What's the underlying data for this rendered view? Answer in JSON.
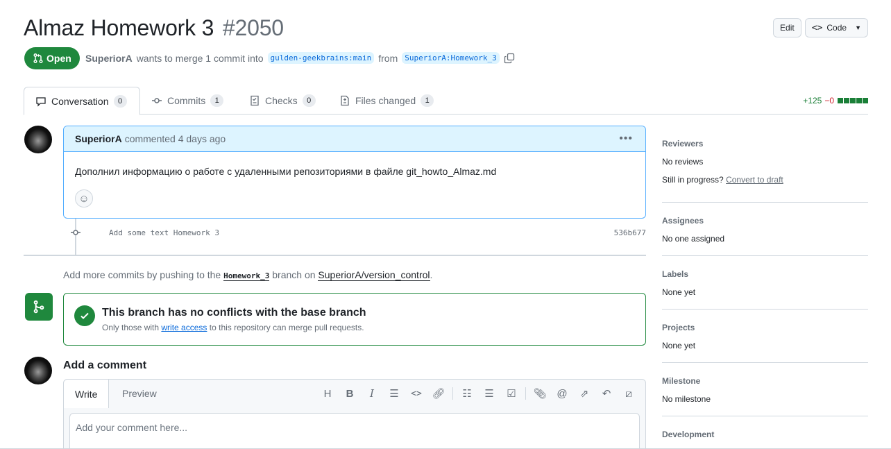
{
  "pr": {
    "title": "Almaz Homework 3",
    "number": "#2050",
    "state": "Open",
    "author": "SuperiorA",
    "merge_text": "wants to merge 1 commit into",
    "base_branch": "gulden-geekbrains:main",
    "from_text": "from",
    "head_branch": "SuperiorA:Homework_3"
  },
  "header_buttons": {
    "edit": "Edit",
    "code": "Code"
  },
  "tabs": [
    {
      "label": "Conversation",
      "count": "0",
      "icon": "comment-icon"
    },
    {
      "label": "Commits",
      "count": "1",
      "icon": "commit-icon"
    },
    {
      "label": "Checks",
      "count": "0",
      "icon": "checklist-icon"
    },
    {
      "label": "Files changed",
      "count": "1",
      "icon": "diff-icon"
    }
  ],
  "diffstat": {
    "added": "+125",
    "removed": "−0"
  },
  "comment": {
    "author": "SuperiorA",
    "meta": "commented 4 days ago",
    "body": "Дополнил информацию о работе с удаленными репозиториями в файле git_howto_Almaz.md"
  },
  "commit": {
    "message": "Add some text Homework 3",
    "sha": "536b677"
  },
  "push_note": {
    "prefix": "Add more commits by pushing to the",
    "branch": "Homework_3",
    "middle": "branch on",
    "repo": "SuperiorA/version_control",
    "suffix": "."
  },
  "merge_status": {
    "title": "This branch has no conflicts with the base branch",
    "sub_prefix": "Only those with",
    "sub_link": "write access",
    "sub_suffix": "to this repository can merge pull requests."
  },
  "add_comment": {
    "heading": "Add a comment",
    "write_tab": "Write",
    "preview_tab": "Preview",
    "placeholder": "Add your comment here..."
  },
  "sidebar": {
    "reviewers": {
      "heading": "Reviewers",
      "value": "No reviews",
      "progress_text": "Still in progress?",
      "progress_link": "Convert to draft"
    },
    "assignees": {
      "heading": "Assignees",
      "value": "No one assigned"
    },
    "labels": {
      "heading": "Labels",
      "value": "None yet"
    },
    "projects": {
      "heading": "Projects",
      "value": "None yet"
    },
    "milestone": {
      "heading": "Milestone",
      "value": "No milestone"
    },
    "development": {
      "heading": "Development"
    }
  },
  "colors": {
    "accent_green": "#1f883d",
    "link_blue": "#0969da",
    "comment_header": "#ddf4ff"
  }
}
